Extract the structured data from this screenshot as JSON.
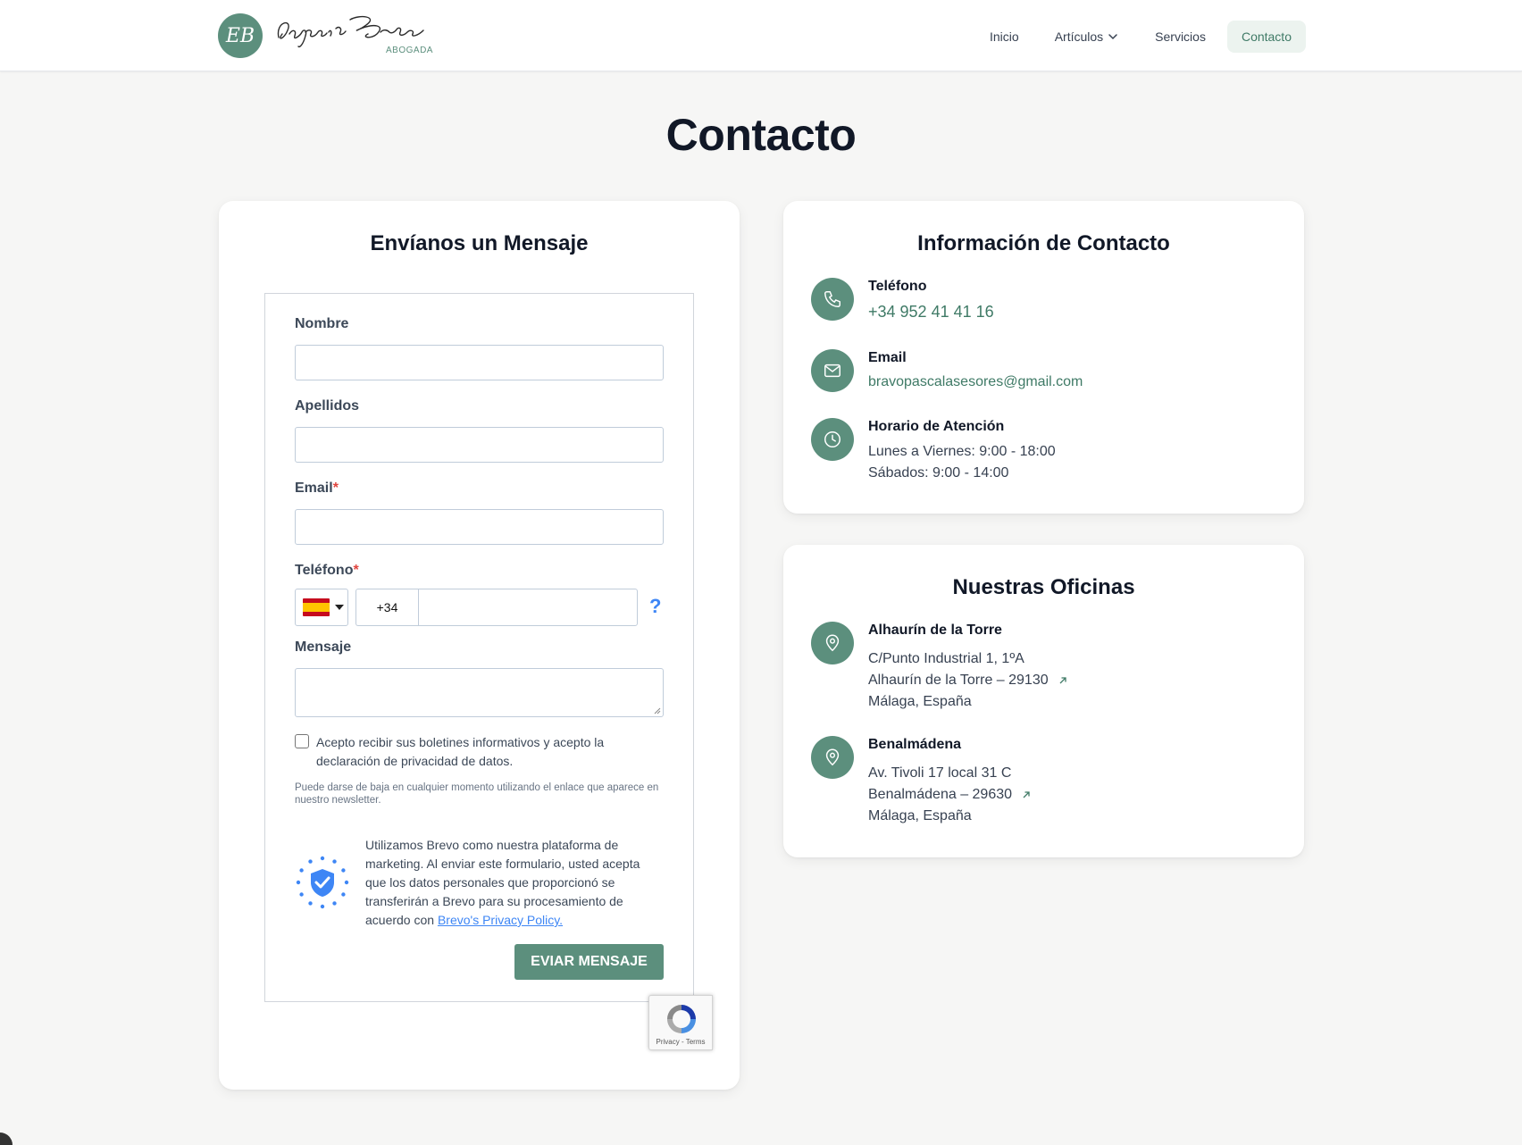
{
  "header": {
    "logo_initials": "EB",
    "logo_subtitle": "ABOGADA",
    "nav": [
      {
        "label": "Inicio"
      },
      {
        "label": "Artículos"
      },
      {
        "label": "Servicios"
      },
      {
        "label": "Contacto"
      }
    ],
    "accent_color": "#5c8f7d"
  },
  "page": {
    "title": "Contacto"
  },
  "form": {
    "title": "Envíanos un Mensaje",
    "fields": {
      "nombre": {
        "label": "Nombre",
        "value": ""
      },
      "apellidos": {
        "label": "Apellidos",
        "value": ""
      },
      "email": {
        "label": "Email",
        "required_mark": "*",
        "value": ""
      },
      "telefono": {
        "label": "Teléfono",
        "required_mark": "*",
        "country_prefix": "+34",
        "help": "?",
        "value": ""
      },
      "mensaje": {
        "label": "Mensaje",
        "value": ""
      }
    },
    "consent_label": "Acepto recibir sus boletines informativos y acepto la declaración de privacidad de datos.",
    "unsubscribe_note": "Puede darse de baja en cualquier momento utilizando el enlace que aparece en nuestro newsletter.",
    "gdpr_text": "Utilizamos Brevo como nuestra plataforma de marketing. Al enviar este formulario, usted acepta que los datos personales que proporcionó se transferirán a Brevo para su procesamiento de acuerdo con ",
    "gdpr_link": "Brevo's Privacy Policy.",
    "submit_label": "EVIAR MENSAJE",
    "recaptcha_text": "Privacy - Terms"
  },
  "contact_info": {
    "title": "Información de Contacto",
    "phone_label": "Teléfono",
    "phone": "+34 952 41 41 16",
    "email_label": "Email",
    "email": "bravopascalasesores@gmail.com",
    "hours_label": "Horario de Atención",
    "hours": [
      "Lunes a Viernes: 9:00 - 18:00",
      "Sábados: 9:00 - 14:00"
    ]
  },
  "offices": {
    "title": "Nuestras Oficinas",
    "items": [
      {
        "name": "Alhaurín de la Torre",
        "lines": [
          "C/Punto Industrial 1, 1ºA",
          "Alhaurín de la Torre – 29130",
          "Málaga, España"
        ]
      },
      {
        "name": "Benalmádena",
        "lines": [
          "Av. Tivoli 17 local 31 C",
          "Benalmádena – 29630",
          "Málaga, España"
        ]
      }
    ]
  }
}
